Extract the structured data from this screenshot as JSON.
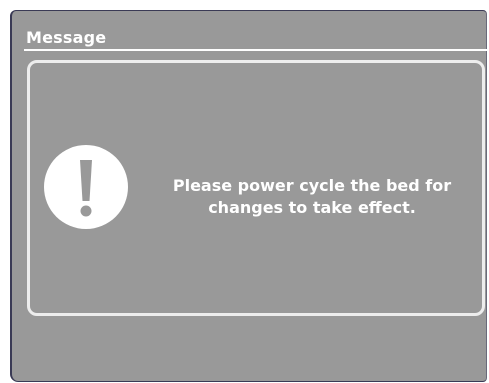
{
  "dialog": {
    "title": "Message",
    "icon": "exclamation-circle-icon",
    "message_line1": "Please power cycle the bed for",
    "message_line2": "changes to take effect."
  },
  "colors": {
    "dialog_background": "#999999",
    "text": "#ffffff",
    "frame": "#3a3a55"
  }
}
